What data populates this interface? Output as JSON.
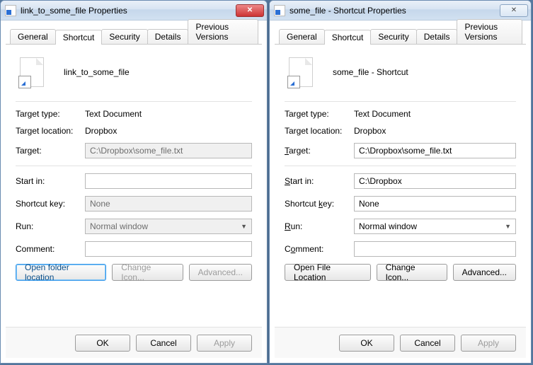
{
  "left": {
    "title": "link_to_some_file Properties",
    "tabs": {
      "general": "General",
      "shortcut": "Shortcut",
      "security": "Security",
      "details": "Details",
      "previous": "Previous Versions"
    },
    "name": "link_to_some_file",
    "labels": {
      "target_type": "Target type:",
      "target_location": "Target location:",
      "target": "Target:",
      "start_in": "Start in:",
      "shortcut_key": "Shortcut key:",
      "run": "Run:",
      "comment": "Comment:"
    },
    "values": {
      "target_type": "Text Document",
      "target_location": "Dropbox",
      "target": "C:\\Dropbox\\some_file.txt",
      "start_in": "",
      "shortcut_key": "None",
      "run": "Normal window",
      "comment": ""
    },
    "buttons": {
      "open_location": "Open folder location",
      "change_icon": "Change Icon...",
      "advanced": "Advanced..."
    },
    "footer": {
      "ok": "OK",
      "cancel": "Cancel",
      "apply": "Apply"
    }
  },
  "right": {
    "title": "some_file - Shortcut Properties",
    "tabs": {
      "general": "General",
      "shortcut": "Shortcut",
      "security": "Security",
      "details": "Details",
      "previous": "Previous Versions"
    },
    "name": "some_file - Shortcut",
    "labels": {
      "target_type": "Target type:",
      "target_location": "Target location:",
      "target": "Target:",
      "start_in": "Start in:",
      "shortcut_key": "Shortcut key:",
      "run": "Run:",
      "comment": "Comment:"
    },
    "underline_letters": {
      "target": "T",
      "start_in": "S",
      "shortcut_key": "k",
      "run": "R",
      "comment": "o"
    },
    "values": {
      "target_type": "Text Document",
      "target_location": "Dropbox",
      "target": "C:\\Dropbox\\some_file.txt",
      "start_in": "C:\\Dropbox",
      "shortcut_key": "None",
      "run": "Normal window",
      "comment": ""
    },
    "buttons": {
      "open_location": "Open File Location",
      "change_icon": "Change Icon...",
      "advanced": "Advanced..."
    },
    "footer": {
      "ok": "OK",
      "cancel": "Cancel",
      "apply": "Apply"
    }
  }
}
